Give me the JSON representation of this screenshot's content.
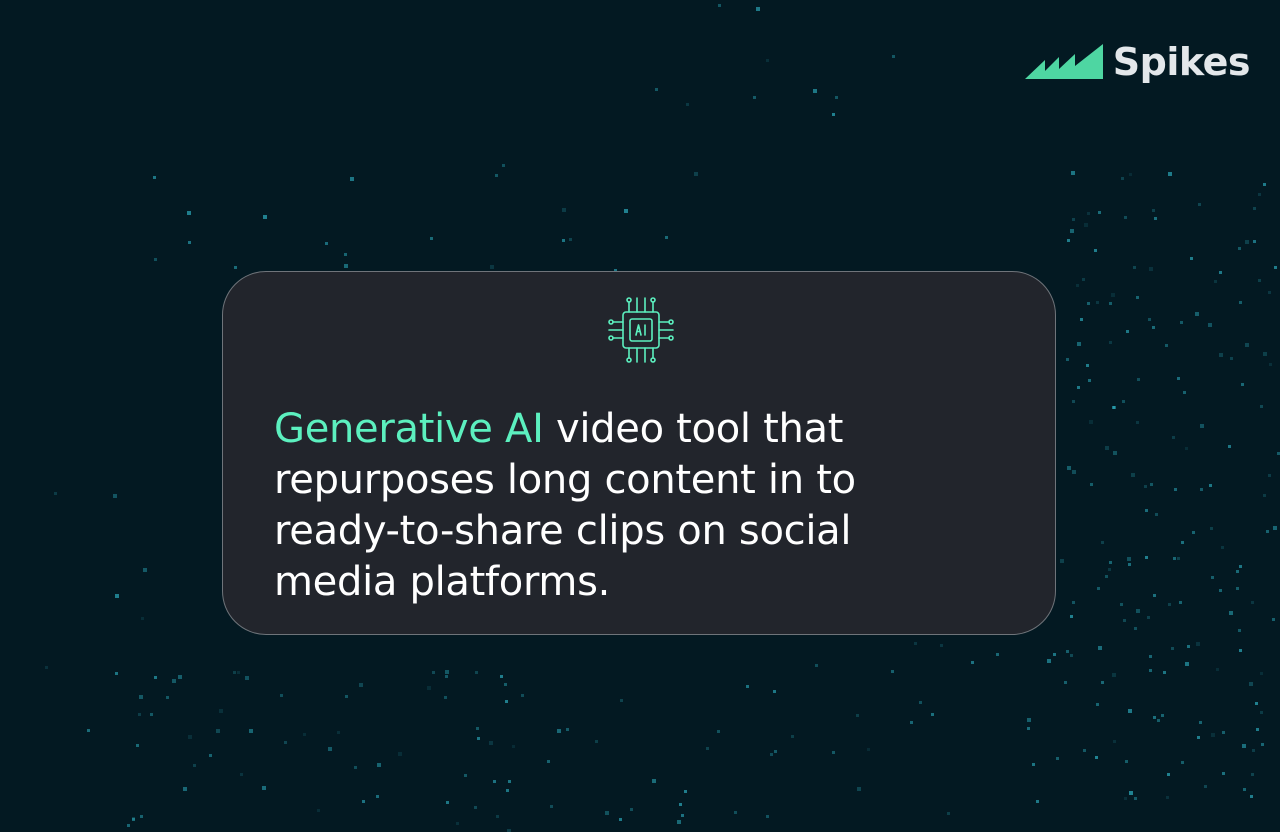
{
  "brand": {
    "name": "Spikes",
    "logo_icon": "bar-spikes-logo-icon",
    "accent_color": "#4ed6a2"
  },
  "card": {
    "icon": "ai-chip-icon",
    "headline_highlight": "Generative AI",
    "headline_rest": " video tool that repurposes long content in to ready-to-share clips on social media platforms.",
    "highlight_color": "#5cf0bf",
    "background_color": "#22252c"
  },
  "page": {
    "background_color": "#031922",
    "particle_color": "#2fb6c8"
  }
}
